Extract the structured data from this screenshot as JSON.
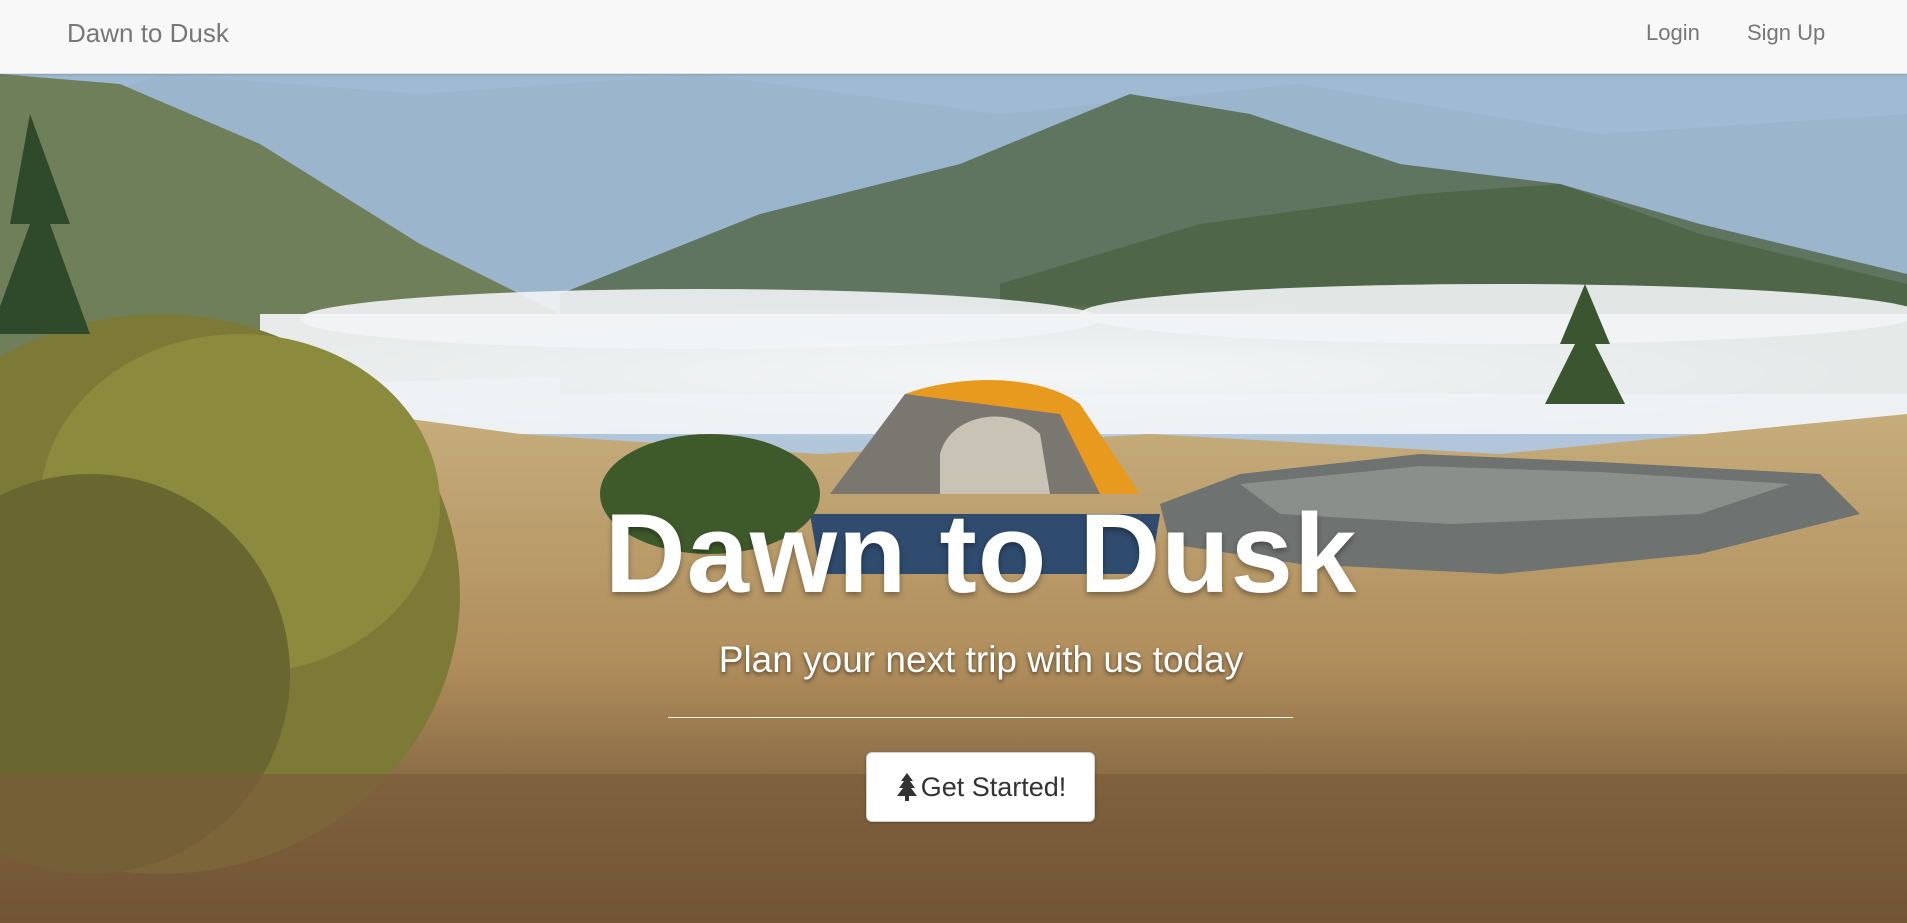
{
  "navbar": {
    "brand": "Dawn to Dusk",
    "links": [
      {
        "label": "Login"
      },
      {
        "label": "Sign Up"
      }
    ]
  },
  "hero": {
    "title": "Dawn to Dusk",
    "subtitle": "Plan your next trip with us today",
    "cta_label": "Get Started!",
    "cta_icon": "tree-icon"
  },
  "colors": {
    "navbar_bg": "#f8f8f8",
    "nav_text": "#777777",
    "hero_text": "#ffffff",
    "button_bg": "#ffffff"
  }
}
